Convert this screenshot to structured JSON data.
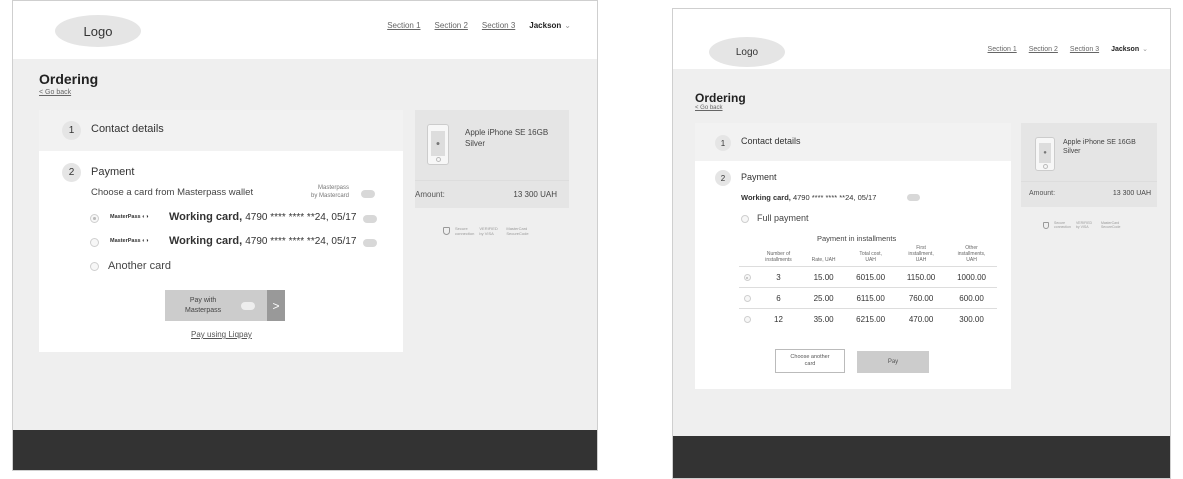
{
  "header": {
    "logo": "Logo",
    "nav": [
      "Section 1",
      "Section 2",
      "Section 3"
    ],
    "user": "Jackson",
    "user_chevron": "⌄"
  },
  "page": {
    "title": "Ordering",
    "back": "< Go back"
  },
  "steps": {
    "contact": {
      "num": "1",
      "title": "Contact details"
    },
    "payment": {
      "num": "2",
      "title": "Payment"
    }
  },
  "screen1": {
    "choose_label": "Choose a card from Masterpass wallet",
    "masterpass_by": [
      "Masterpass",
      "by Mastercard"
    ],
    "cards": [
      {
        "brand": "MasterPass ◐◑",
        "name": "Working card,",
        "number": "4790 **** **** **24, 05/17",
        "selected": true
      },
      {
        "brand": "MasterPass ◐◑",
        "name": "Working card,",
        "number": "4790 **** **** **24, 05/17",
        "selected": false
      }
    ],
    "another_card": "Another card",
    "pay_with": [
      "Pay with",
      "Masterpass"
    ],
    "pay_arrow": ">",
    "liqpay": "Pay using Liqpay"
  },
  "screen2": {
    "working_card_bold": "Working card,",
    "working_card_rest": "4790 **** **** **24, 05/17",
    "full_payment": "Full payment",
    "installments_title": "Payment in installments",
    "columns": [
      [
        "Number of",
        "installments"
      ],
      [
        "Rate, UAH"
      ],
      [
        "Total cost,",
        "UAH"
      ],
      [
        "First",
        "installment,",
        "UAH"
      ],
      [
        "Other",
        "installments,",
        "UAH"
      ]
    ],
    "rows": [
      {
        "n": "3",
        "rate": "15.00",
        "total": "6015.00",
        "first": "1150.00",
        "other": "1000.00",
        "selected": true
      },
      {
        "n": "6",
        "rate": "25.00",
        "total": "6115.00",
        "first": "760.00",
        "other": "600.00",
        "selected": false
      },
      {
        "n": "12",
        "rate": "35.00",
        "total": "6215.00",
        "first": "470.00",
        "other": "300.00",
        "selected": false
      }
    ],
    "choose_another": [
      "Choose another",
      "card"
    ],
    "pay": "Pay"
  },
  "summary": {
    "product": [
      "Apple iPhone SE 16GB",
      "Silver"
    ],
    "amount_label": "Amount:",
    "amount_value": "13 300 UAH",
    "secure": [
      "Secure",
      "connection"
    ],
    "badges": [
      "VERIFIED by VISA",
      "MasterCard SecureCode"
    ]
  }
}
